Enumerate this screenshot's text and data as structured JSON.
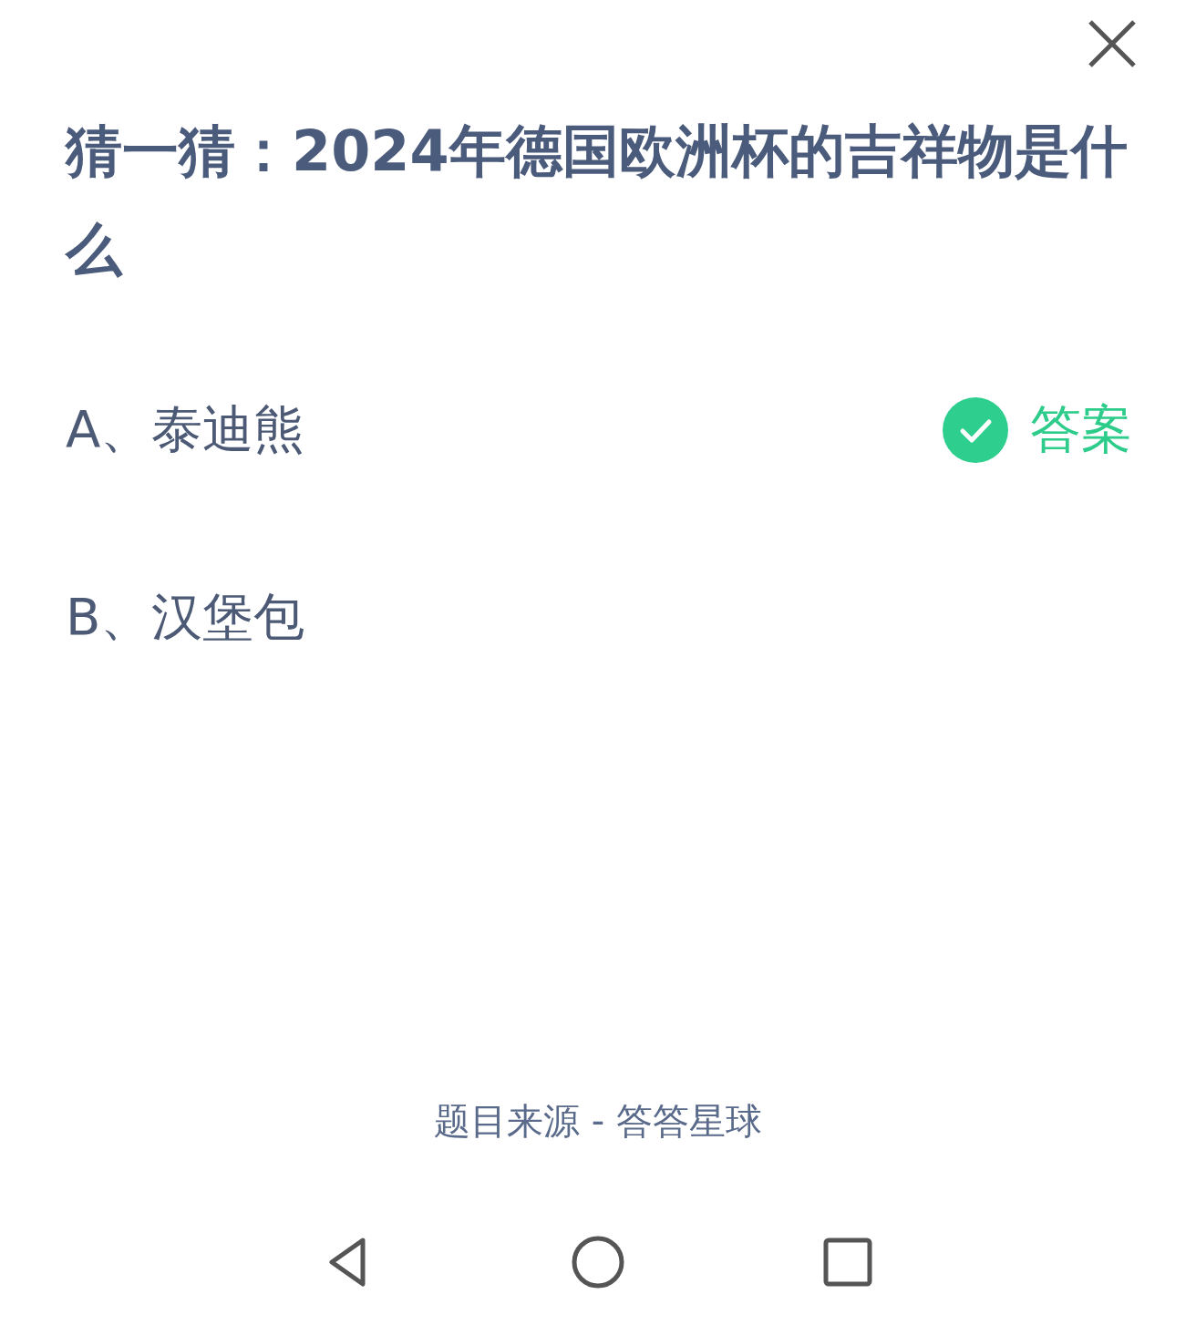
{
  "title": "猜一猜：2024年德国欧洲杯的吉祥物是什么",
  "answer_badge": "答案",
  "options": [
    {
      "label": "A、泰迪熊",
      "correct": true
    },
    {
      "label": "B、汉堡包",
      "correct": false
    }
  ],
  "footer": "题目来源 - 答答星球",
  "nav_bar": [
    {
      "kind": "back"
    },
    {
      "kind": "home"
    },
    {
      "kind": "recents"
    }
  ]
}
